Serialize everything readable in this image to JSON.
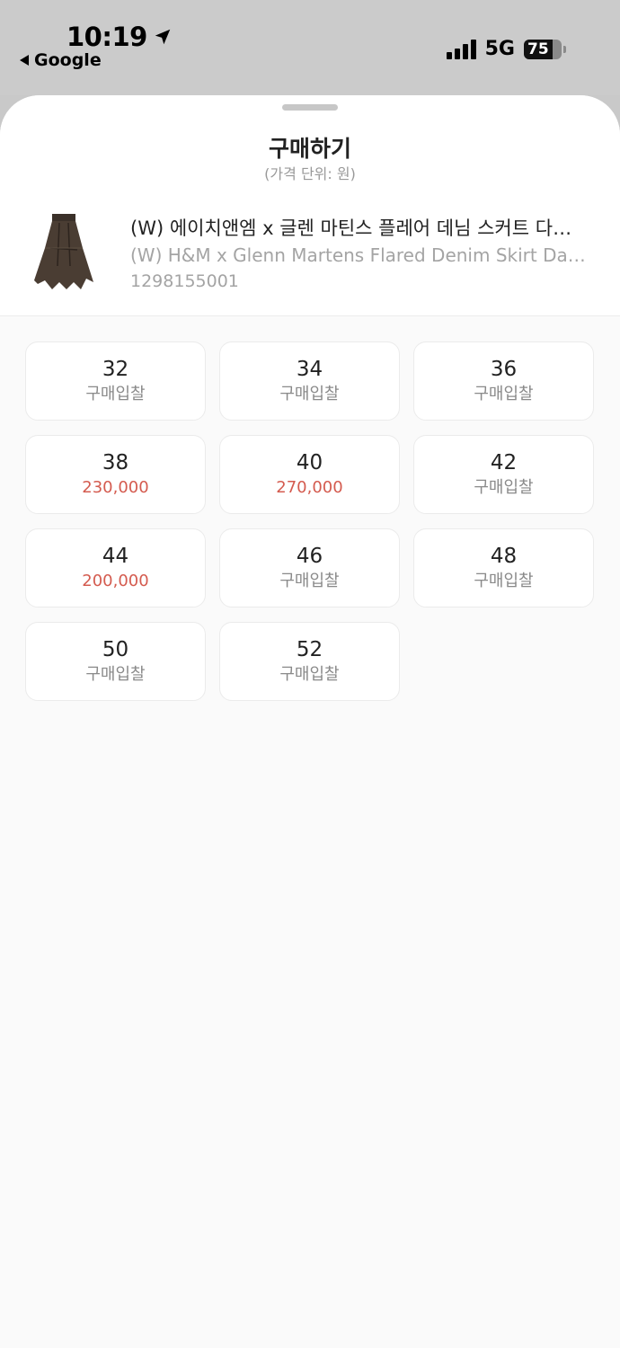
{
  "status_bar": {
    "time": "10:19",
    "back_app": "Google",
    "network": "5G",
    "battery": "75",
    "battery_level": 0.75
  },
  "sheet": {
    "title": "구매하기",
    "subtitle": "(가격 단위: 원)"
  },
  "product": {
    "name": "(W) 에이치앤엠 x 글렌 마틴스 플레어 데님 스커트 다크 브라운",
    "name_en": "(W) H&M x Glenn Martens Flared Denim Skirt Dark Brown",
    "code": "1298155001",
    "image_icon": "denim-skirt-thumbnail"
  },
  "sizes": [
    {
      "size": "32",
      "price": "구매입찰"
    },
    {
      "size": "34",
      "price": "구매입찰"
    },
    {
      "size": "36",
      "price": "구매입찰"
    },
    {
      "size": "38",
      "price": "230,000"
    },
    {
      "size": "40",
      "price": "270,000"
    },
    {
      "size": "42",
      "price": "구매입찰"
    },
    {
      "size": "44",
      "price": "200,000"
    },
    {
      "size": "46",
      "price": "구매입찰"
    },
    {
      "size": "48",
      "price": "구매입찰"
    },
    {
      "size": "50",
      "price": "구매입찰"
    },
    {
      "size": "52",
      "price": "구매입찰"
    }
  ],
  "colors": {
    "price_accent": "#d45b4f",
    "bid_text": "#8a8a8a"
  }
}
